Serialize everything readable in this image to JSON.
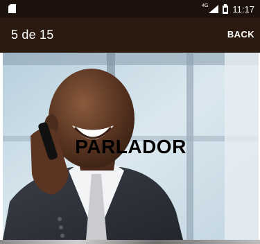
{
  "status_bar": {
    "network_label": "4G",
    "time": "11:17",
    "icons": [
      "sd-card-icon",
      "signal-icon",
      "battery-icon"
    ]
  },
  "app_bar": {
    "title": "5 de 15",
    "back_label": "BACK"
  },
  "photo": {
    "caption": "PARLADOR",
    "icon": "man-on-phone-photo"
  },
  "colors": {
    "status_bar_bg": "#1d120b",
    "app_bar_bg": "#2b1a10",
    "text_light": "#ffffff",
    "caption_color": "#000000"
  }
}
